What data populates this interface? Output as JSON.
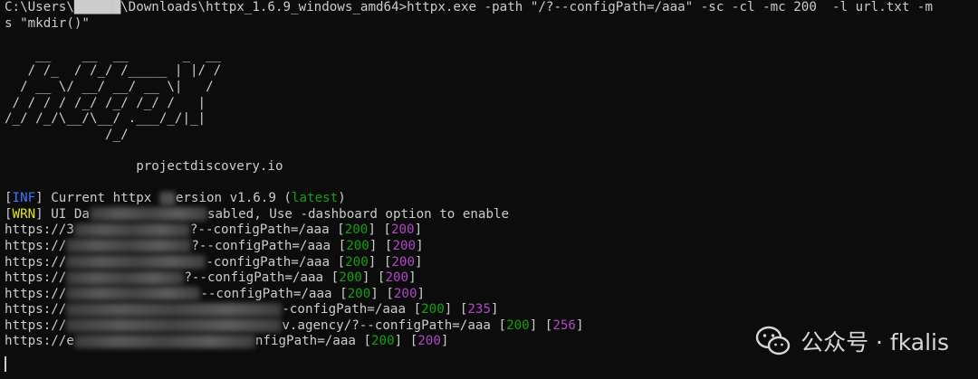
{
  "command": {
    "line1": "C:\\Users\\██████\\Downloads\\httpx_1.6.9_windows_amd64>httpx.exe -path \"/?--configPath=/aaa\" -sc -cl -mc 200  -l url.txt -m",
    "line2": "s \"mkdir()\""
  },
  "banner": {
    "art": [
      "    __    __  __       _  __",
      "   / /_  / /_/ /_____ | |/ /",
      "  / __ \\/ __/ __/ __ \\|   /",
      " / / / / /_/ /_/ /_/ /   |",
      "/_/ /_/\\__/\\__/ .___/_/|_|",
      "             /_/"
    ],
    "site": "projectdiscovery.io"
  },
  "messages": {
    "inf_tag": "INF",
    "inf_text_pre": " Current httpx ",
    "inf_text_post": "ersion v1.6.9 (",
    "inf_latest": "latest",
    "inf_close": ")",
    "wrn_tag": "WRN",
    "wrn_text_pre": " UI Da",
    "wrn_text_post": "sabled, Use -dashboard option to enable"
  },
  "results": [
    {
      "prefix": "https://3",
      "suffix": "?--configPath=/aaa ",
      "status": "200",
      "length": "200"
    },
    {
      "prefix": "https://",
      "suffix": "?--configPath=/aaa ",
      "status": "200",
      "length": "200"
    },
    {
      "prefix": "https://",
      "suffix": "-configPath=/aaa ",
      "status": "200",
      "length": "200"
    },
    {
      "prefix": "https://",
      "suffix": "?--configPath=/aaa ",
      "status": "200",
      "length": "200"
    },
    {
      "prefix": "https://",
      "suffix": "--configPath=/aaa ",
      "status": "200",
      "length": "200"
    },
    {
      "prefix": "https://",
      "suffix": "-configPath=/aaa ",
      "status": "200",
      "length": "235"
    },
    {
      "prefix": "https://",
      "suffix": "v.agency/?--configPath=/aaa ",
      "status": "200",
      "length": "256"
    },
    {
      "prefix": "https://e",
      "suffix": "nfigPath=/aaa ",
      "status": "200",
      "length": "200"
    }
  ],
  "watermark": {
    "text": "公众号 · fkalis",
    "icon": "wechat-icon"
  },
  "colors": {
    "background": "#0c0c0c",
    "foreground": "#cccccc",
    "info": "#3b78ff",
    "warn": "#e5e510",
    "status_green": "#13a10e",
    "length_magenta": "#b148c6"
  }
}
